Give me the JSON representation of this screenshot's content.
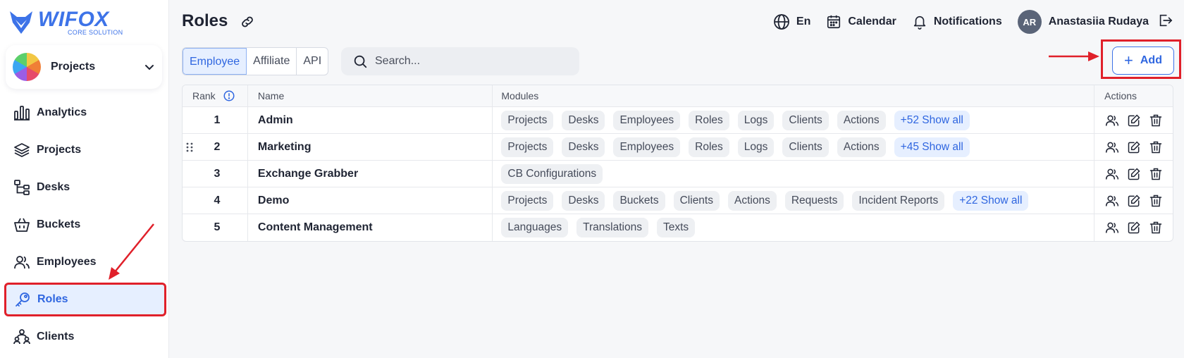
{
  "brand": {
    "name": "WIFOX",
    "tagline": "CORE SOLUTION",
    "accent": "#3d73e8"
  },
  "project_selector": {
    "label": "Projects"
  },
  "sidebar": {
    "items": [
      {
        "label": "Analytics",
        "icon": "bar-chart-icon"
      },
      {
        "label": "Projects",
        "icon": "layers-icon"
      },
      {
        "label": "Desks",
        "icon": "hierarchy-icon"
      },
      {
        "label": "Buckets",
        "icon": "basket-icon"
      },
      {
        "label": "Employees",
        "icon": "users-icon"
      },
      {
        "label": "Roles",
        "icon": "key-icon",
        "active": true
      },
      {
        "label": "Clients",
        "icon": "clients-icon"
      }
    ]
  },
  "header": {
    "title": "Roles",
    "language": "En",
    "calendar": "Calendar",
    "notifications": "Notifications",
    "user": {
      "initials": "AR",
      "name": "Anastasiia Rudaya"
    }
  },
  "tabs": [
    {
      "label": "Employee",
      "active": true
    },
    {
      "label": "Affiliate"
    },
    {
      "label": "API"
    }
  ],
  "search": {
    "placeholder": "Search..."
  },
  "add_button": {
    "label": "Add"
  },
  "table": {
    "columns": [
      "Rank",
      "Name",
      "Modules",
      "Actions"
    ],
    "rows": [
      {
        "rank": "1",
        "name": "Admin",
        "modules": [
          "Projects",
          "Desks",
          "Employees",
          "Roles",
          "Logs",
          "Clients",
          "Actions"
        ],
        "more": "+52 Show all"
      },
      {
        "rank": "2",
        "name": "Marketing",
        "modules": [
          "Projects",
          "Desks",
          "Employees",
          "Roles",
          "Logs",
          "Clients",
          "Actions"
        ],
        "more": "+45 Show all"
      },
      {
        "rank": "3",
        "name": "Exchange Grabber",
        "modules": [
          "CB Configurations"
        ],
        "more": ""
      },
      {
        "rank": "4",
        "name": "Demo",
        "modules": [
          "Projects",
          "Desks",
          "Buckets",
          "Clients",
          "Actions",
          "Requests",
          "Incident Reports"
        ],
        "more": "+22 Show all"
      },
      {
        "rank": "5",
        "name": "Content Management",
        "modules": [
          "Languages",
          "Translations",
          "Texts"
        ],
        "more": ""
      }
    ]
  },
  "colors": {
    "highlight": "#e0202a",
    "active_bg": "#e6efff",
    "link": "#2f66e0"
  }
}
